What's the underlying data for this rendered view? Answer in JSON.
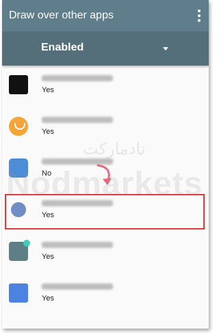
{
  "appbar": {
    "title": "Draw over other apps",
    "menu_icon": "more-vert-icon"
  },
  "filter": {
    "selected": "Enabled"
  },
  "apps": [
    {
      "icon": "account-manager-icon",
      "status": "Yes"
    },
    {
      "icon": "album-icon",
      "status": "Yes"
    },
    {
      "icon": "amazon-app-icon",
      "status": "No"
    },
    {
      "icon": "android-system-icon",
      "status": "Yes"
    },
    {
      "icon": "calculator-icon",
      "status": "Yes"
    },
    {
      "icon": "calendar-icon",
      "status": "Yes"
    }
  ],
  "watermark": {
    "latin": "Nodmarkets",
    "persian": "نادمارکت"
  },
  "colors": {
    "appbar": "#607d8b",
    "spinner": "#546e7a",
    "highlight": "#e23a3a",
    "arrow": "#e46a78"
  }
}
